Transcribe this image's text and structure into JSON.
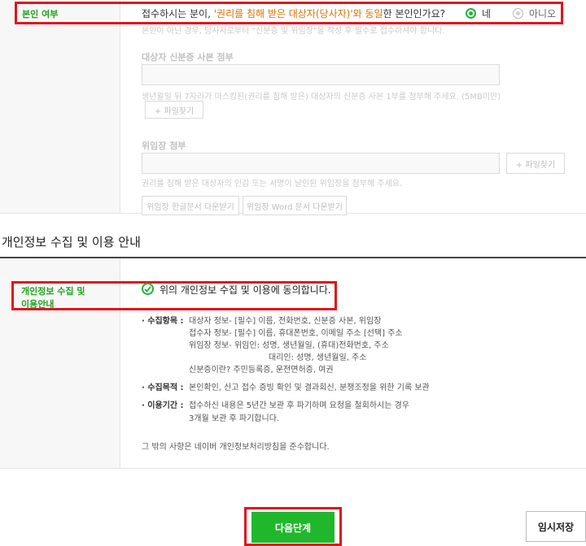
{
  "identity": {
    "label": "본인 여부",
    "question_pre": "접수하시는 분이, ",
    "question_highlight": "'권리를 침해 받은 대상자(당사자)'와 동일",
    "question_post": "한 본인인가요?",
    "option_yes": "네",
    "option_no": "아니오",
    "note": "본인이 아닌 경우, 당사자로부터 \"신분증 및 위임장\"을 작성 후 필수로 접수하셔야 합니다."
  },
  "id_copy": {
    "title": "대상자 신분증 사본 첨부",
    "desc": "생년월일 뒤 7자리가 마스킹된(권리를 침해 받은) 대상자의 신분증 사본 1부를 첨부해 주세요. (5MB미만)",
    "button": "+ 파일찾기"
  },
  "proxy": {
    "title": "위임장 첨부",
    "button": "+ 파일찾기",
    "desc": "권리를 침해 받은 대상자의 인감 또는 서명이 날인된 위임장을 첨부해 주세요.",
    "download_hwp": "위임장 한글문서 다운받기",
    "download_word": "위임장 Word 문서 다운받기"
  },
  "privacy": {
    "section_title": "개인정보 수집 및 이용 안내",
    "label_line1": "개인정보 수집 및",
    "label_line2": "이용안내",
    "agree_text": "위의 개인정보 수집 및 이용에 동의합니다.",
    "items_label": "· 수집항목 :",
    "items": [
      "대상자 정보- [필수] 이름, 전화번호, 신분증 사본, 위임장",
      "접수자 정보- [필수] 이름, 휴대폰번호, 이메일 주소 [선택] 주소",
      "위임장 정보- 위임인: 성명, 생년월일, (휴대)전화번호, 주소",
      "대리인: 성명, 생년월일, 주소",
      "신분증이란? 주민등록증, 운전면허증, 여권"
    ],
    "purpose_label": "· 수집목적 :",
    "purpose": "본인확인, 신고 접수 증빙 확인 및 결과회신, 분쟁조정을 위한 기록 보관",
    "period_label": "· 이용기간 :",
    "period_line1": "접수하신 내용은 5년간 보관 후 파기하며 요청을 철회하시는 경우",
    "period_line2": "3개월 보관 후 파기합니다.",
    "footer": "그 밖의 사항은 네이버 개인정보처리방침을 준수합니다."
  },
  "actions": {
    "next": "다음단계",
    "save": "임시저장"
  },
  "colors": {
    "accent_green": "#21b72c",
    "highlight_red": "#e1141e",
    "question_orange": "#e07000"
  }
}
